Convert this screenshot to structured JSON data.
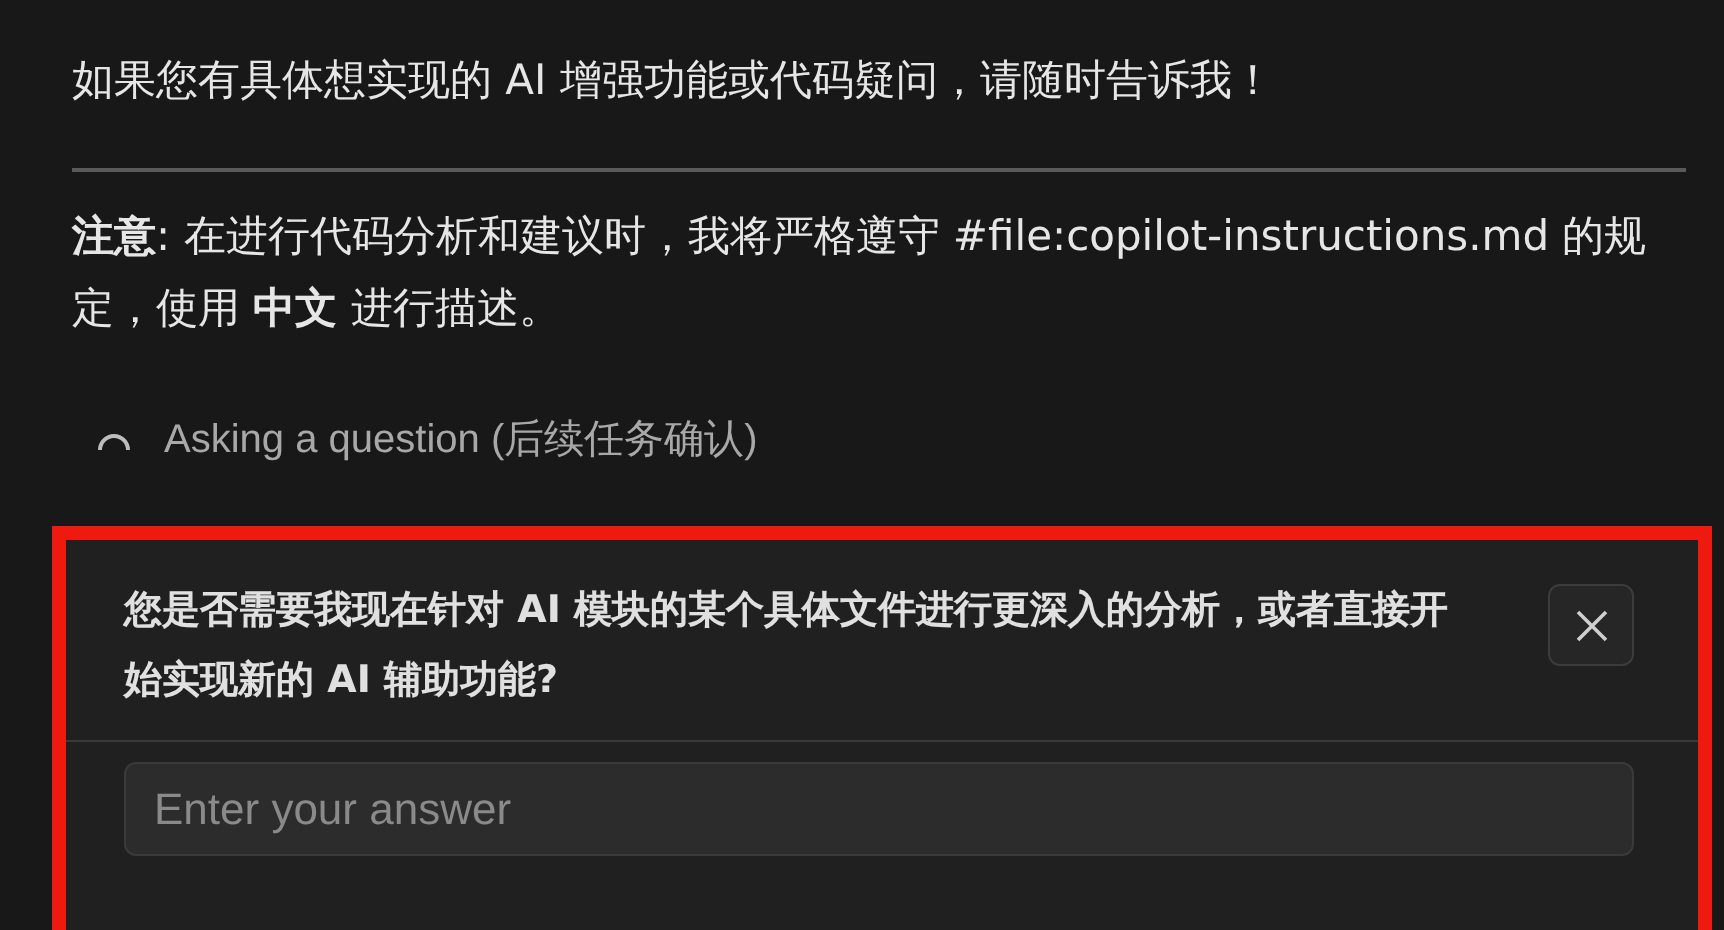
{
  "message": {
    "paragraph": "如果您有具体想实现的 AI 增强功能或代码疑问，请随时告诉我！",
    "note": "**注意**: 在进行代码分析和建议时，我将严格遵守 #file:copilot-instructions.md 的规定，使用 **中文** 进行描述。"
  },
  "status": {
    "text": "Asking a question (后续任务确认)",
    "loading": true
  },
  "question_panel": {
    "highlighted": true,
    "question": "您是否需要我现在针对 AI 模块的某个具体文件进行更深入的分析，或者直接开始实现新的 AI 辅助功能?",
    "answer": {
      "placeholder": "Enter your answer"
    }
  }
}
